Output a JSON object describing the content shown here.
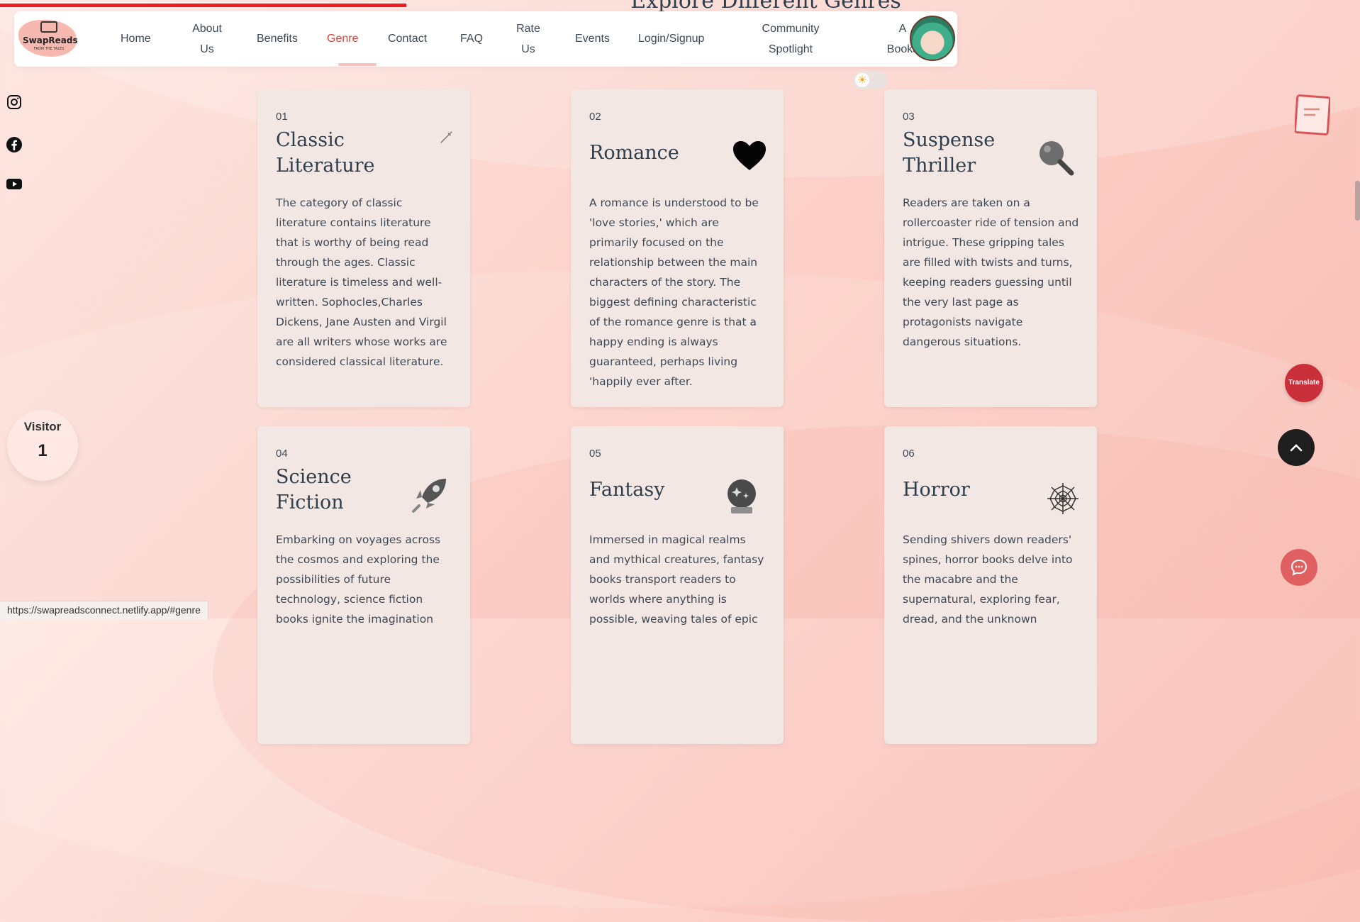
{
  "page": {
    "section_title": "Explore Different Genres",
    "reading_progress_percent": 30
  },
  "nav": {
    "logo": {
      "name": "SwapReads",
      "tagline": "FROM THE TALES"
    },
    "items": [
      {
        "label": "Home"
      },
      {
        "label": "About Us"
      },
      {
        "label": "Benefits"
      },
      {
        "label": "Genre",
        "active": true
      },
      {
        "label": "Contact"
      },
      {
        "label": "FAQ"
      },
      {
        "label": "Rate Us"
      },
      {
        "label": "Events"
      },
      {
        "label": "Login/Signup"
      },
      {
        "label": "Community Spotlight"
      },
      {
        "label": "All Books"
      }
    ],
    "labels_wrapped": {
      "about_1": "About",
      "about_2": "Us",
      "rate_1": "Rate",
      "rate_2": "Us",
      "community_1": "Community",
      "community_2": "Spotlight",
      "books_1": "A",
      "books_2": "Books"
    },
    "avatar_icon": "anime-avatar-icon"
  },
  "theme_toggle": {
    "icon": "sun-icon",
    "state": "light"
  },
  "social": [
    {
      "icon": "instagram-icon"
    },
    {
      "icon": "facebook-icon"
    },
    {
      "icon": "youtube-icon"
    }
  ],
  "visitor": {
    "label": "Visitor",
    "count": "1"
  },
  "genres": [
    {
      "num": "01",
      "title": "Classic Literature",
      "icon": "quill-pen-icon",
      "desc": "The category of classic literature contains literature that is worthy of being read through the ages. Classic literature is timeless and well-written. Sophocles,Charles Dickens, Jane Austen and Virgil are all writers whose works are considered classical literature."
    },
    {
      "num": "02",
      "title": "Romance",
      "icon": "heart-icon",
      "desc": "A romance is understood to be 'love stories,' which are primarily focused on the relationship between the main characters of the story. The biggest defining characteristic of the romance genre is that a happy ending is always guaranteed, perhaps living 'happily ever after."
    },
    {
      "num": "03",
      "title": "Suspense Thriller",
      "icon": "magnifying-glass-icon",
      "desc": "Readers are taken on a rollercoaster ride of tension and intrigue. These gripping tales are filled with twists and turns, keeping readers guessing until the very last page as protagonists navigate dangerous situations."
    },
    {
      "num": "04",
      "title": "Science Fiction",
      "icon": "rocket-icon",
      "desc": "Embarking on voyages across the cosmos and exploring the possibilities of future technology, science fiction books ignite the imagination"
    },
    {
      "num": "05",
      "title": "Fantasy",
      "icon": "crystal-ball-icon",
      "desc": "Immersed in magical realms and mythical creatures, fantasy books transport readers to worlds where anything is possible, weaving tales of epic"
    },
    {
      "num": "06",
      "title": "Horror",
      "icon": "spider-web-icon",
      "desc": "Sending shivers down readers' spines, horror books delve into the macabre and the supernatural, exploring fear, dread, and the unknown"
    }
  ],
  "floating": {
    "notes_icon": "notepad-icon",
    "translate_label": "Translate",
    "scroll_top_icon": "chevron-up-icon",
    "chat_icon": "chat-bubble-icon"
  },
  "status_url": "https://swapreadsconnect.netlify.app/#genre",
  "colors": {
    "accent": "#d4443c",
    "card_bg": "#f3e7e3",
    "text": "#2f3e4d",
    "progress": "#ee1c25"
  }
}
